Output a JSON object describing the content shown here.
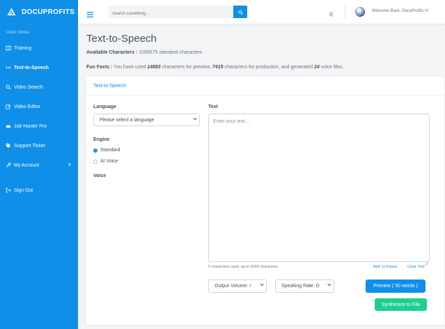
{
  "brand": {
    "name": "DOCUPROFITS"
  },
  "sidebar": {
    "panel_label": "USER PANEL",
    "items": [
      {
        "label": "Training",
        "icon": "book-icon"
      },
      {
        "label": "Text-to-Speech",
        "icon": "broadcast-icon",
        "active": true
      },
      {
        "label": "Video Search",
        "icon": "search-icon"
      },
      {
        "label": "Video Editor",
        "icon": "edit-icon"
      },
      {
        "label": "Job Hunter Pro",
        "icon": "car-icon"
      },
      {
        "label": "Support Ticket",
        "icon": "tag-icon"
      },
      {
        "label": "My Account",
        "icon": "wrench-icon",
        "has_submenu": true
      },
      {
        "label": "Sign Out",
        "icon": "sign-out-icon"
      }
    ]
  },
  "topbar": {
    "search_placeholder": "Search something...",
    "welcome": "Welcome Back, DocuProfits IV"
  },
  "page": {
    "title": "Text-to-Speech",
    "available_label": "Available Characters :",
    "available_value": "1005675 standard characters",
    "funfacts_label": "Fun Facts :",
    "funfacts_text1": "You have used",
    "preview_chars": "14883",
    "funfacts_text2": "characters for preview,",
    "production_chars": "7415",
    "funfacts_text3": "characters for production, and generated",
    "voice_files": "24",
    "funfacts_text4": "voice files."
  },
  "form": {
    "card_title": "Text-to-Speech",
    "language_label": "Language",
    "language_value": "Please select a language",
    "engine_label": "Engine",
    "engine_options": [
      {
        "label": "Standard",
        "checked": true
      },
      {
        "label": "AI Voice",
        "checked": false
      }
    ],
    "voice_label": "Voice",
    "text_label": "Text",
    "text_placeholder": "Enter your text...",
    "counter": "0 characters used, up to 3000 characters",
    "add_pause": "Add 1s Pause",
    "clear_text": "Clear Text",
    "output_volume": "Output Volume: I",
    "speaking_rate": "Speaking Rate: D",
    "preview_button": "Preview ( 50 words )",
    "synthesize_button": "Synthesize to File"
  },
  "colors": {
    "primary": "#0f8fe8",
    "success": "#1fcf8f"
  }
}
